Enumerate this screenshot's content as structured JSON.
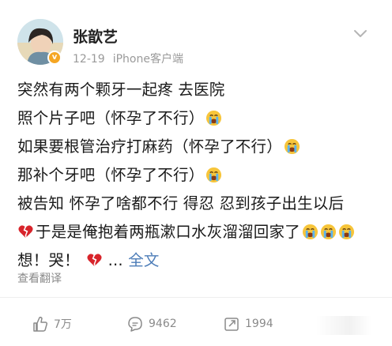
{
  "post": {
    "username": "张歆艺",
    "date": "12-19",
    "device": "iPhone客户端",
    "lines": [
      "突然有两个颗牙一起疼 去医院",
      "照个片子吧（怀孕了不行）",
      "如果要根管治疗打麻药（怀孕了不行）",
      "那补个牙吧（怀孕了不行）",
      "被告知 怀孕了啥都不行 得忍 忍到孩子出生以后",
      "于是是俺抱着两瓶漱口水灰溜溜回家了",
      "想！哭！"
    ],
    "ellipsis": "...",
    "full_text_link": "全文",
    "translate_label": "查看翻译"
  },
  "actions": {
    "like_count": "7万",
    "comment_count": "9462",
    "repost_count": "1994"
  },
  "icons": {
    "verified_badge": "v-badge-icon",
    "crying_emoji": "crying-face-icon",
    "broken_heart": "broken-heart-icon"
  },
  "colors": {
    "link": "#4d7db8",
    "muted": "#9a9a9a",
    "badge": "#f5a623"
  }
}
